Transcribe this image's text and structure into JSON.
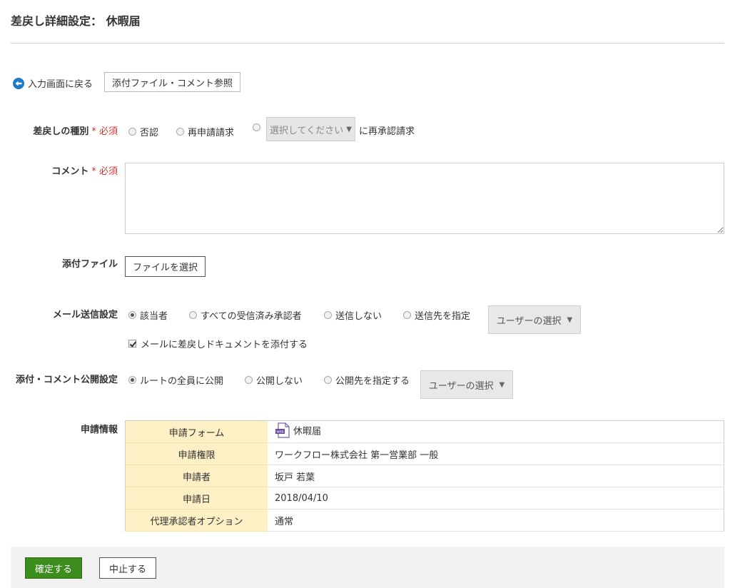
{
  "page": {
    "title": "差戻し詳細設定： 休暇届"
  },
  "toolbar": {
    "back_label": "入力画面に戻る",
    "attachments_button": "添付ファイル・コメント参照"
  },
  "form": {
    "required_mark": "* 必須",
    "sendback_type": {
      "label": "差戻しの種別",
      "options": [
        "否認",
        "再申請請求"
      ],
      "select_placeholder": "選択してください",
      "suffix": "に再承認請求"
    },
    "comment": {
      "label": "コメント",
      "value": ""
    },
    "attachment": {
      "label": "添付ファイル",
      "button": "ファイルを選択"
    },
    "mail": {
      "label": "メール送信設定",
      "options": [
        "該当者",
        "すべての受信済み承認者",
        "送信しない",
        "送信先を指定"
      ],
      "selected": "該当者",
      "user_button": "ユーザーの選択",
      "attach_checkbox": "メールに差戻しドキュメントを添付する"
    },
    "publish": {
      "label": "添付・コメント公開設定",
      "options": [
        "ルートの全員に公開",
        "公開しない",
        "公開先を指定する"
      ],
      "selected": "ルートの全員に公開",
      "user_button": "ユーザーの選択"
    },
    "info": {
      "label": "申請情報",
      "rows": [
        {
          "key": "申請フォーム",
          "value": "休暇届"
        },
        {
          "key": "申請権限",
          "value": "ワークフロー株式会社 第一営業部 一般"
        },
        {
          "key": "申請者",
          "value": "坂戸 若葉"
        },
        {
          "key": "申請日",
          "value": "2018/04/10"
        },
        {
          "key": "代理承認者オプション",
          "value": "通常"
        }
      ],
      "form_icon_label": "web"
    }
  },
  "footer": {
    "confirm": "確定する",
    "cancel": "中止する"
  },
  "colors": {
    "confirm_bg": "#3c8d1e",
    "required": "#d43535",
    "info_key_bg": "#fcf0c4",
    "back_icon": "#1a7ac7"
  }
}
